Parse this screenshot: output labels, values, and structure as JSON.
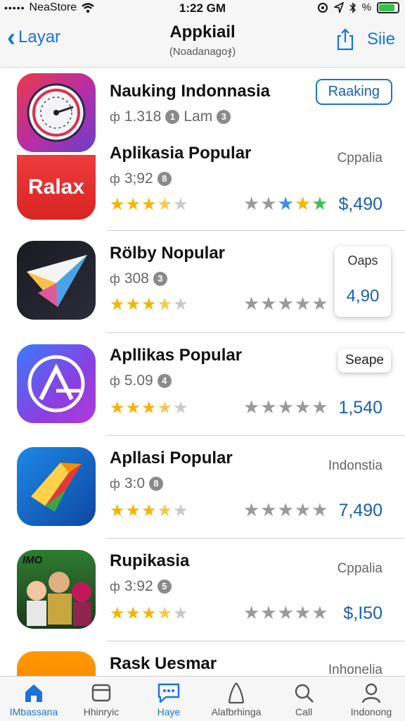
{
  "status_bar": {
    "signal": "•••••",
    "carrier": "NeaStore",
    "time": "1:22 GM",
    "battery_text": "%"
  },
  "nav": {
    "back_label": "Layar",
    "title": "Appkiail",
    "subtitle": "(Noadanagoჯ)",
    "right_label": "Siie"
  },
  "apps": [
    {
      "name": "Nauking Indonnasia",
      "meta_value": "1.318",
      "meta_badge": "1",
      "meta_extra": "Lam",
      "meta_badge2": "3",
      "button_label": "Raaking",
      "icon": "speedometer-icon"
    },
    {
      "name": "Aplikasia Popular",
      "meta_value": "3;92",
      "meta_badge": "8",
      "tag": "Cppalia",
      "price": "$,490",
      "icon_text": "Ralax",
      "icon": "ralax-app-icon"
    },
    {
      "name": "Rölby Nopular",
      "meta_value": "308",
      "meta_badge": "3",
      "card_label": "Oaps",
      "card_value": "4,90",
      "icon": "paper-plane-icon"
    },
    {
      "name": "Apllikas Popular",
      "meta_value": "5.09",
      "meta_badge": "4",
      "card_label": "Seape",
      "price": "1,540",
      "icon": "compass-a-icon"
    },
    {
      "name": "Apllasi Popular",
      "meta_value": "3:0",
      "meta_badge": "8",
      "tag": "Indonstia",
      "price": "7,490",
      "icon": "colorful-arrow-icon"
    },
    {
      "name": "Rupikasia",
      "meta_value": "3:92",
      "meta_badge": "5",
      "tag": "Cppalia",
      "price": "$,I50",
      "icon_text": "IMO",
      "icon": "cartoon-game-icon"
    },
    {
      "name": "Rask Uesmar",
      "tag": "Inhonelia",
      "icon": "orange-app-icon"
    }
  ],
  "tabs": [
    {
      "label": "IMbassana",
      "icon": "home-icon",
      "active": true
    },
    {
      "label": "Hhinryic",
      "icon": "window-icon",
      "active": false
    },
    {
      "label": "Haye",
      "icon": "chat-bubble-icon",
      "active": true
    },
    {
      "label": "Alafbrhinga",
      "icon": "person-outline-icon",
      "active": false
    },
    {
      "label": "Call",
      "icon": "search-icon",
      "active": false
    },
    {
      "label": "Indonong",
      "icon": "profile-icon",
      "active": false
    }
  ],
  "colors": {
    "accent": "#1a73d9",
    "price": "#1a5fb4",
    "star": "#f5b400"
  }
}
